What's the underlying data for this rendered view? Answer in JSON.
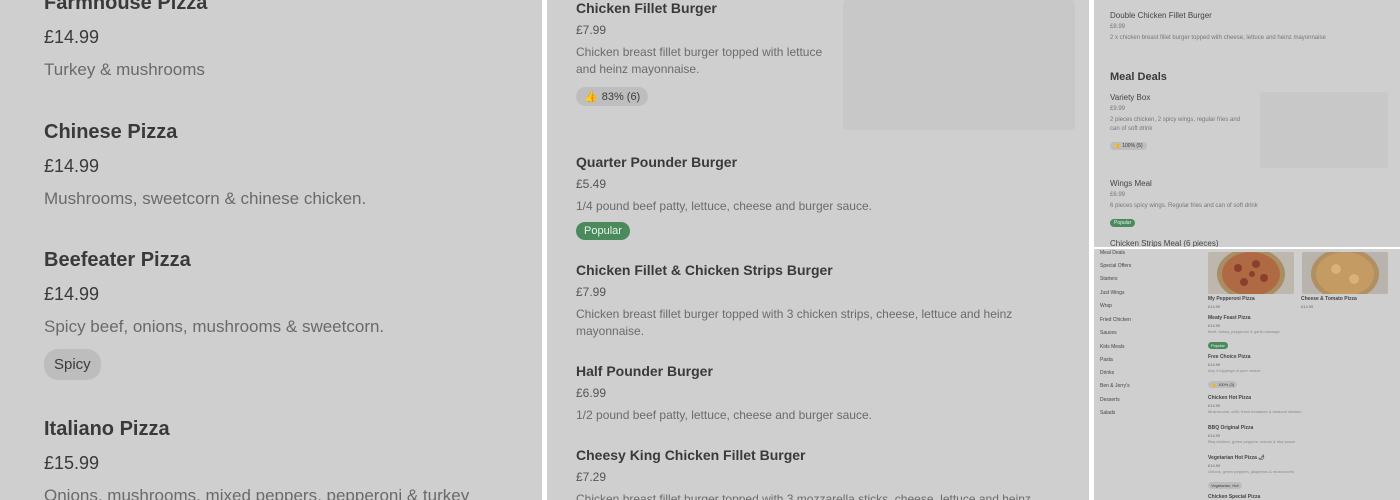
{
  "panel1": {
    "items": [
      {
        "name": "Farmhouse Pizza",
        "price": "£14.99",
        "desc": "Turkey & mushrooms"
      },
      {
        "name": "Chinese Pizza",
        "price": "£14.99",
        "desc": "Mushrooms, sweetcorn & chinese chicken."
      },
      {
        "name": "Beefeater Pizza",
        "price": "£14.99",
        "desc": "Spicy beef, onions, mushrooms & sweetcorn.",
        "tag": "Spicy"
      },
      {
        "name": "Italiano Pizza",
        "price": "£15.99",
        "desc": "Onions, mushrooms, mixed peppers, pepperoni & turkey"
      }
    ]
  },
  "panel2": {
    "items": [
      {
        "name": "Chicken Fillet Burger",
        "price": "£7.99",
        "desc": "Chicken breast fillet burger topped with lettuce and heinz mayonnaise.",
        "rating": "83% (6)"
      },
      {
        "name": "Quarter Pounder Burger",
        "price": "£5.49",
        "desc": "1/4 pound beef patty, lettuce, cheese and burger sauce.",
        "badge": "Popular"
      },
      {
        "name": "Chicken Fillet & Chicken Strips Burger",
        "price": "£7.99",
        "desc": "Chicken breast fillet burger topped with 3 chicken strips, cheese, lettuce and heinz mayonnaise."
      },
      {
        "name": "Half Pounder Burger",
        "price": "£6.99",
        "desc": "1/2 pound beef patty, lettuce, cheese and burger sauce."
      },
      {
        "name": "Cheesy King Chicken Fillet Burger",
        "price": "£7.29",
        "desc": "Chicken breast fillet burger topped with 3 mozzarella sticks, cheese, lettuce and heinz"
      }
    ]
  },
  "panel3": {
    "top_item": {
      "name": "Double Chicken Fillet Burger",
      "price": "£8.99",
      "desc": "2 x chicken breast fillet burger topped with cheese, lettuce and heinz mayonnaise"
    },
    "section_title": "Meal Deals",
    "items": [
      {
        "name": "Variety Box",
        "price": "£9.99",
        "desc": "2 pieces chicken, 2 spicy wings, regular fries and can of soft drink",
        "rating": "100% (5)"
      },
      {
        "name": "Wings Meal",
        "price": "£6.99",
        "desc": "6 pieces spicy wings. Regular fries and can of soft drink",
        "badge": "Popular"
      },
      {
        "name": "Chicken Strips Meal (6 pieces)"
      }
    ]
  },
  "panel4": {
    "categories": [
      "Meal Deals",
      "Special Offers",
      "Starters",
      "Just Wings",
      "Wrap",
      "Fried Chicken",
      "Sauces",
      "Kids Meals",
      "Pasta",
      "Drinks",
      "Ben & Jerry's",
      "Desserts",
      "Salads"
    ],
    "featured": [
      {
        "name": "My Pepperoni Pizza",
        "price": "£14.99"
      },
      {
        "name": "Cheese & Tomato Pizza",
        "price": "£14.99"
      }
    ],
    "items": [
      {
        "name": "Meaty Feast Pizza",
        "price": "£14.99",
        "desc": "Beef, turkey, pepperoni & garlic sausage",
        "badge": "Popular"
      },
      {
        "name": "Free Choice Pizza",
        "price": "£14.99",
        "desc": "Any 4 toppings of your choice",
        "rating": "100% (3)"
      },
      {
        "name": "Chicken Hot Pizza",
        "price": "£14.99",
        "desc": "Mushrooms, chilli, fresh tomatoes & tandoori chicken"
      },
      {
        "name": "BBQ Original Pizza",
        "price": "£14.99",
        "desc": "Bbq chicken, green peppers, onions & bbq sauce"
      },
      {
        "name": "Vegetarian Hot Pizza 🌶",
        "price": "£14.99",
        "desc": "Onions, green peppers, jalapenos & mushrooms",
        "tag": "Vegetarian, Hot"
      },
      {
        "name": "Chicken Special Pizza"
      }
    ]
  },
  "colors": {
    "panel_bg": "#cfcfcf",
    "popular_badge": "#4a8a5c",
    "tag_bg": "#bdbdbd"
  },
  "icons": {
    "rating": "thumbs-up-icon"
  }
}
